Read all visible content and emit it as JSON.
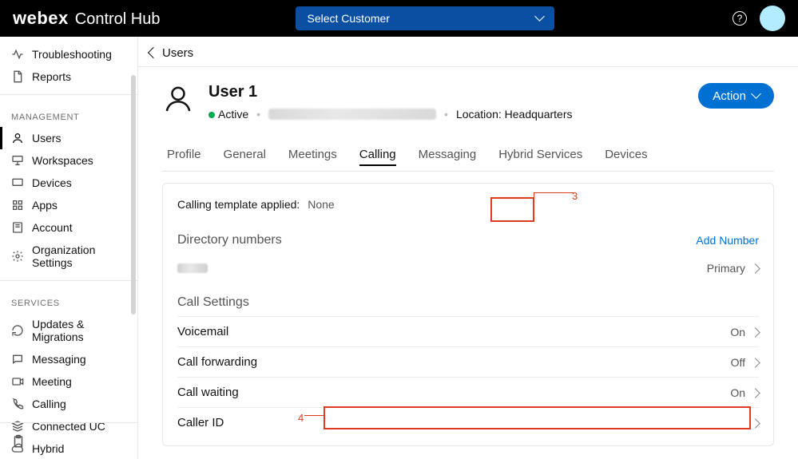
{
  "topbar": {
    "brand_logo": "webex",
    "brand_product": "Control Hub",
    "customer_placeholder": "Select Customer"
  },
  "sidebar": {
    "top": [
      {
        "label": "Troubleshooting"
      },
      {
        "label": "Reports"
      }
    ],
    "section_management": "Management",
    "management": [
      {
        "label": "Users",
        "active": true
      },
      {
        "label": "Workspaces"
      },
      {
        "label": "Devices"
      },
      {
        "label": "Apps"
      },
      {
        "label": "Account"
      },
      {
        "label": "Organization Settings"
      }
    ],
    "section_services": "Services",
    "services": [
      {
        "label": "Updates & Migrations"
      },
      {
        "label": "Messaging"
      },
      {
        "label": "Meeting"
      },
      {
        "label": "Calling"
      },
      {
        "label": "Connected UC"
      },
      {
        "label": "Hybrid"
      }
    ]
  },
  "crumb": {
    "back_label": "Users"
  },
  "user": {
    "name": "User 1",
    "status": "Active",
    "location_label": "Location: Headquarters",
    "action_button": "Action"
  },
  "tabs": [
    {
      "label": "Profile"
    },
    {
      "label": "General"
    },
    {
      "label": "Meetings"
    },
    {
      "label": "Calling",
      "active": true
    },
    {
      "label": "Messaging"
    },
    {
      "label": "Hybrid Services"
    },
    {
      "label": "Devices"
    }
  ],
  "calling": {
    "template_label": "Calling template applied:",
    "template_value": "None",
    "dir_num_title": "Directory numbers",
    "add_number": "Add Number",
    "dir_primary": "Primary",
    "call_settings_title": "Call Settings",
    "rows": [
      {
        "label": "Voicemail",
        "value": "On"
      },
      {
        "label": "Call forwarding",
        "value": "Off"
      },
      {
        "label": "Call waiting",
        "value": "On"
      },
      {
        "label": "Caller ID",
        "value": ""
      }
    ]
  },
  "annotations": {
    "num3": "3",
    "num4": "4"
  }
}
